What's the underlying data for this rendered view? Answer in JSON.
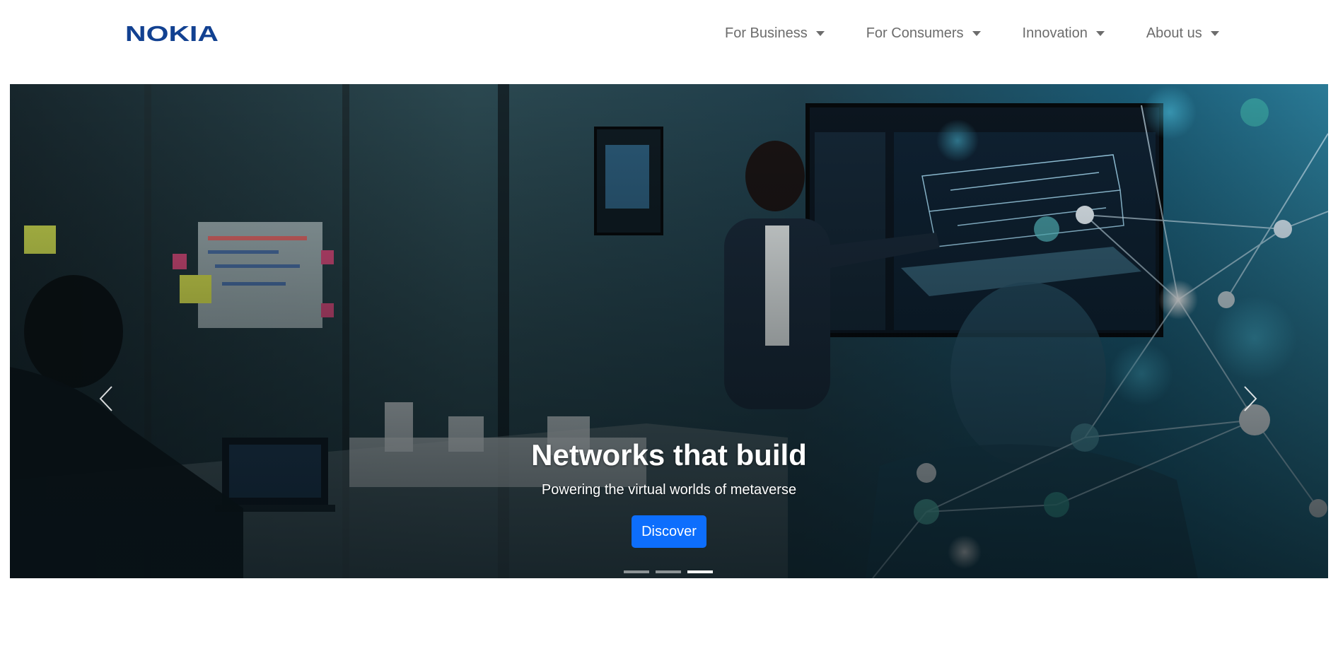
{
  "header": {
    "brand_name": "NOKIA",
    "nav_items": [
      {
        "label": "For Business"
      },
      {
        "label": "For Consumers"
      },
      {
        "label": "Innovation"
      },
      {
        "label": "About us"
      }
    ]
  },
  "hero": {
    "title": "Networks that build",
    "subtitle": "Powering the virtual worlds of metaverse",
    "cta_label": "Discover",
    "prev_icon": "chevron-left-icon",
    "next_icon": "chevron-right-icon",
    "slide_count": 3,
    "active_slide": 3
  },
  "colors": {
    "brand": "#124191",
    "nav_text": "#6c6c6c",
    "cta_background": "#0d6efd",
    "hero_overlay": "#0f2a36"
  }
}
